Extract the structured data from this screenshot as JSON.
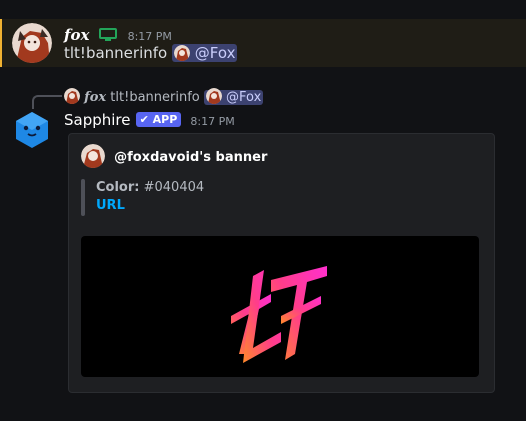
{
  "message1": {
    "author": "fox",
    "timestamp": "8:17 PM",
    "content_prefix": "tlt!bannerinfo",
    "mention": "@Fox"
  },
  "reply": {
    "author": "fox",
    "content_prefix": "tlt!bannerinfo",
    "mention": "@Fox"
  },
  "message2": {
    "author": "Sapphire",
    "badge": "APP",
    "timestamp": "8:17 PM"
  },
  "embed": {
    "author": "@foxdavoid's banner",
    "color_label": "Color:",
    "color_value": "#040404",
    "url_label": "URL"
  },
  "colors": {
    "mention_bg": "#3c4270",
    "highlight_border": "#f0b232",
    "app_badge": "#5865f2",
    "link": "#00a8fc",
    "status_icon": "#23a55a"
  },
  "banner_logo_text": "TLT"
}
